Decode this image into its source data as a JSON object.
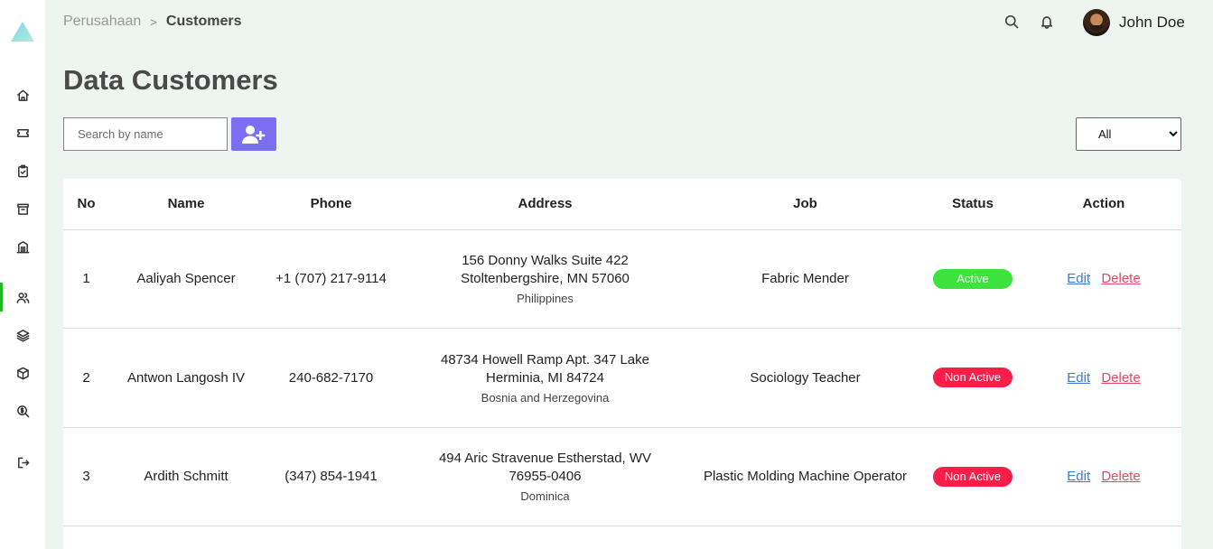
{
  "colors": {
    "accent": "#7a6ff0",
    "active": "#3be33b",
    "inactive": "#fa1e48",
    "sidebar_active": "#22b822",
    "background": "#eef5f1"
  },
  "sidebar": {
    "logo": "triangle-logo",
    "items": [
      {
        "icon": "home-icon",
        "active": false
      },
      {
        "icon": "ticket-icon",
        "active": false
      },
      {
        "icon": "clipboard-check-icon",
        "active": false
      },
      {
        "icon": "archive-icon",
        "active": false
      },
      {
        "icon": "building-icon",
        "active": false
      },
      {
        "icon": "users-icon",
        "active": true
      },
      {
        "icon": "layers-icon",
        "active": false
      },
      {
        "icon": "box-icon",
        "active": false
      },
      {
        "icon": "search-dollar-icon",
        "active": false
      },
      {
        "icon": "logout-icon",
        "active": false
      }
    ]
  },
  "breadcrumb": {
    "parent": "Perusahaan",
    "separator": ">",
    "current": "Customers"
  },
  "header": {
    "user_name": "John Doe",
    "icons": [
      "search-icon",
      "bell-icon"
    ]
  },
  "page_title": "Data Customers",
  "toolbar": {
    "search_placeholder": "Search by name",
    "add_icon": "user-plus-icon",
    "filter_value": "All"
  },
  "table": {
    "columns": [
      "No",
      "Name",
      "Phone",
      "Address",
      "Job",
      "Status",
      "Action"
    ],
    "edit_label": "Edit",
    "delete_label": "Delete",
    "rows": [
      {
        "no": "1",
        "name": "Aaliyah Spencer",
        "phone": "+1 (707) 217-9114",
        "address": "156 Donny Walks Suite 422 Stoltenbergshire, MN 57060",
        "country": "Philippines",
        "job": "Fabric Mender",
        "status": "Active",
        "status_type": "active"
      },
      {
        "no": "2",
        "name": "Antwon Langosh IV",
        "phone": "240-682-7170",
        "address": "48734 Howell Ramp Apt. 347 Lake Herminia, MI 84724",
        "country": "Bosnia and Herzegovina",
        "job": "Sociology Teacher",
        "status": "Non Active",
        "status_type": "inactive"
      },
      {
        "no": "3",
        "name": "Ardith Schmitt",
        "phone": "(347) 854-1941",
        "address": "494 Aric Stravenue Estherstad, WV 76955-0406",
        "country": "Dominica",
        "job": "Plastic Molding Machine Operator",
        "status": "Non Active",
        "status_type": "inactive"
      }
    ]
  }
}
